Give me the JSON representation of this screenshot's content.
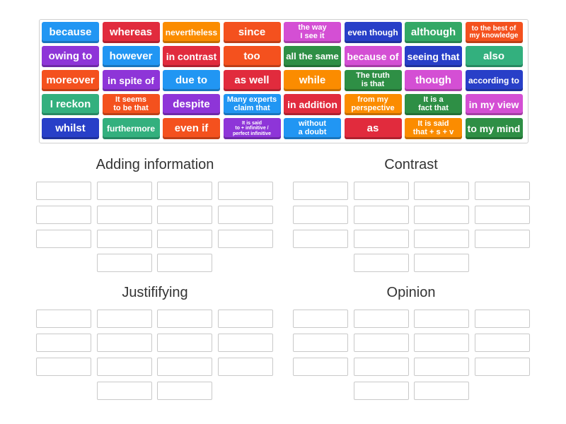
{
  "colors": {
    "blue": "#2196f3",
    "red": "#e12b3d",
    "orange": "#fb8c00",
    "orange_red": "#f4511e",
    "pink": "#d44fd4",
    "navy": "#283fc8",
    "green": "#33a866",
    "dark_green": "#2e8f45",
    "purple": "#8e35d8",
    "teal": "#33b07e"
  },
  "tiles": [
    {
      "text": "because",
      "color": "blue",
      "size": 15
    },
    {
      "text": "whereas",
      "color": "red",
      "size": 15
    },
    {
      "text": "nevertheless",
      "color": "orange",
      "size": 12
    },
    {
      "text": "since",
      "color": "orange_red",
      "size": 15
    },
    {
      "text": "the way\nI see it",
      "color": "pink",
      "size": 11
    },
    {
      "text": "even though",
      "color": "navy",
      "size": 12
    },
    {
      "text": "although",
      "color": "green",
      "size": 15
    },
    {
      "text": "to the best of\nmy knowledge",
      "color": "orange_red",
      "size": 10
    },
    {
      "text": "owing to",
      "color": "purple",
      "size": 15
    },
    {
      "text": "however",
      "color": "blue",
      "size": 15
    },
    {
      "text": "in contrast",
      "color": "red",
      "size": 14
    },
    {
      "text": "too",
      "color": "orange_red",
      "size": 15
    },
    {
      "text": "all the same",
      "color": "dark_green",
      "size": 13
    },
    {
      "text": "because of",
      "color": "pink",
      "size": 14
    },
    {
      "text": "seeing that",
      "color": "navy",
      "size": 14
    },
    {
      "text": "also",
      "color": "teal",
      "size": 15
    },
    {
      "text": "moreover",
      "color": "orange_red",
      "size": 15
    },
    {
      "text": "in spite of",
      "color": "purple",
      "size": 14
    },
    {
      "text": "due to",
      "color": "blue",
      "size": 15
    },
    {
      "text": "as well",
      "color": "red",
      "size": 15
    },
    {
      "text": "while",
      "color": "orange",
      "size": 15
    },
    {
      "text": "The truth\nis that",
      "color": "dark_green",
      "size": 11
    },
    {
      "text": "though",
      "color": "pink",
      "size": 15
    },
    {
      "text": "according to",
      "color": "navy",
      "size": 12
    },
    {
      "text": "I reckon",
      "color": "teal",
      "size": 15
    },
    {
      "text": "It seems\nto be that",
      "color": "orange_red",
      "size": 11
    },
    {
      "text": "despite",
      "color": "purple",
      "size": 15
    },
    {
      "text": "Many experts\nclaim that",
      "color": "blue",
      "size": 11
    },
    {
      "text": "in addition",
      "color": "red",
      "size": 14
    },
    {
      "text": "from my\nperspective",
      "color": "orange",
      "size": 11
    },
    {
      "text": "It is a\nfact that",
      "color": "dark_green",
      "size": 11
    },
    {
      "text": "in my view",
      "color": "pink",
      "size": 14
    },
    {
      "text": "whilst",
      "color": "navy",
      "size": 15
    },
    {
      "text": "furthermore",
      "color": "teal",
      "size": 12
    },
    {
      "text": "even if",
      "color": "orange_red",
      "size": 15
    },
    {
      "text": "It is said\nto + infinitive /\nperfect infinitive",
      "color": "purple",
      "size": 7
    },
    {
      "text": "without\na doubt",
      "color": "blue",
      "size": 11
    },
    {
      "text": "as",
      "color": "red",
      "size": 15
    },
    {
      "text": "It is said\nthat + s + v",
      "color": "orange",
      "size": 11
    },
    {
      "text": "to my mind",
      "color": "dark_green",
      "size": 14
    }
  ],
  "groups": [
    {
      "name": "Adding information",
      "slots": 14
    },
    {
      "name": "Contrast",
      "slots": 14
    },
    {
      "name": "Justififying",
      "slots": 14
    },
    {
      "name": "Opinion",
      "slots": 14
    }
  ]
}
